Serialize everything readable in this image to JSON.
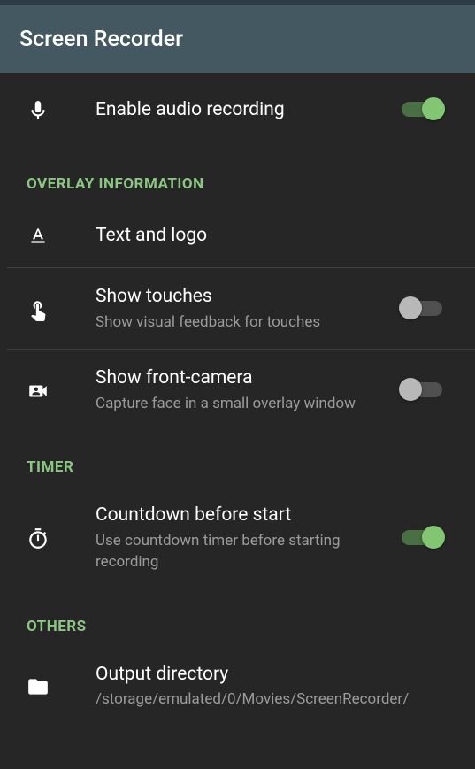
{
  "header": {
    "title": "Screen Recorder"
  },
  "settings": {
    "audio": {
      "title": "Enable audio recording",
      "enabled": true
    },
    "sections": {
      "overlay": {
        "label": "OVERLAY INFORMATION",
        "text_logo": {
          "title": "Text and logo"
        },
        "show_touches": {
          "title": "Show touches",
          "subtitle": "Show visual feedback for touches",
          "enabled": false
        },
        "front_camera": {
          "title": "Show front-camera",
          "subtitle": "Capture face in a small overlay window",
          "enabled": false
        }
      },
      "timer": {
        "label": "TIMER",
        "countdown": {
          "title": "Countdown before start",
          "subtitle": "Use countdown timer before starting recording",
          "enabled": true
        }
      },
      "others": {
        "label": "OTHERS",
        "output_dir": {
          "title": "Output directory",
          "subtitle": "/storage/emulated/0/Movies/ScreenRecorder/"
        }
      }
    }
  }
}
